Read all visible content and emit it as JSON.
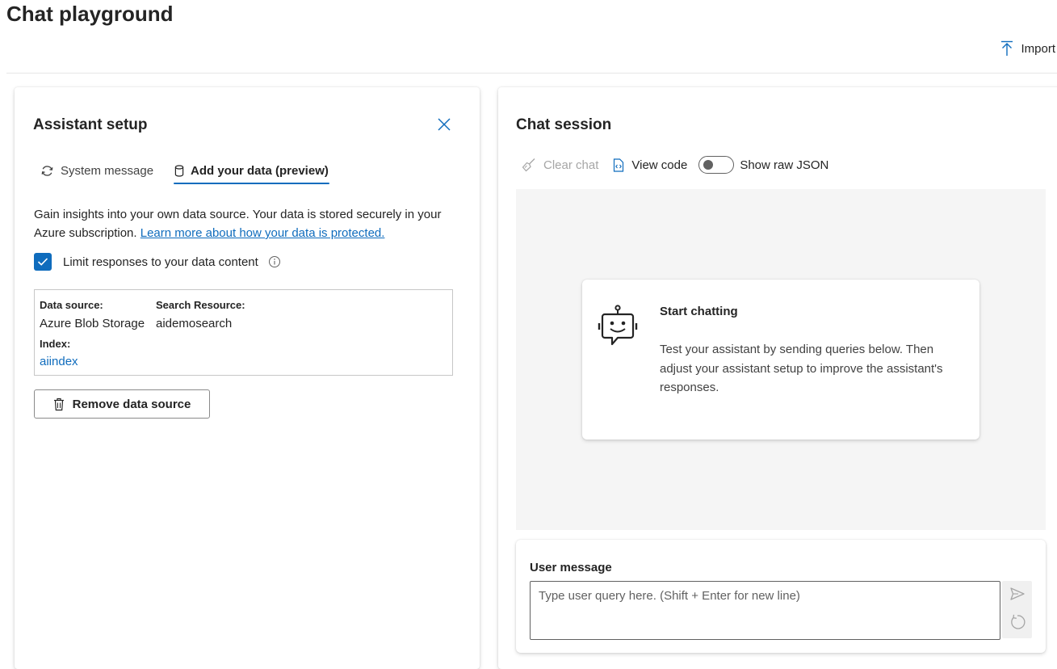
{
  "page": {
    "title": "Chat playground",
    "import_label": "Import"
  },
  "assistant_setup": {
    "title": "Assistant setup",
    "tabs": [
      {
        "label": "System message",
        "active": false
      },
      {
        "label": "Add your data (preview)",
        "active": true
      }
    ],
    "description": "Gain insights into your own data source. Your data is stored securely in your Azure subscription.",
    "learn_more_link": "Learn more about how your data is protected.",
    "limit_checkbox": {
      "label": "Limit responses to your data content",
      "checked": true
    },
    "data_source": {
      "source_label": "Data source:",
      "source_value": "Azure Blob Storage",
      "resource_label": "Search Resource:",
      "resource_value": "aidemosearch",
      "index_label": "Index:",
      "index_value": "aiindex"
    },
    "remove_button": "Remove data source"
  },
  "chat_session": {
    "title": "Chat session",
    "toolbar": {
      "clear_chat": "Clear chat",
      "view_code": "View code",
      "show_raw_json": "Show raw JSON",
      "raw_json_on": false
    },
    "start_card": {
      "title": "Start chatting",
      "text": "Test your assistant by sending queries below. Then adjust your assistant setup to improve the assistant's responses."
    },
    "user_message": {
      "label": "User message",
      "placeholder": "Type user query here. (Shift + Enter for new line)",
      "value": ""
    }
  },
  "colors": {
    "accent": "#0f6cbd",
    "text": "#242424",
    "disabled": "#a6a6a6",
    "chat_bg": "#f5f5f5"
  },
  "icons": [
    "upload-icon",
    "close-icon",
    "refresh-icon",
    "database-icon",
    "checkmark-icon",
    "info-icon",
    "trash-icon",
    "broom-icon",
    "code-file-icon",
    "bot-icon",
    "send-icon",
    "reset-icon"
  ]
}
